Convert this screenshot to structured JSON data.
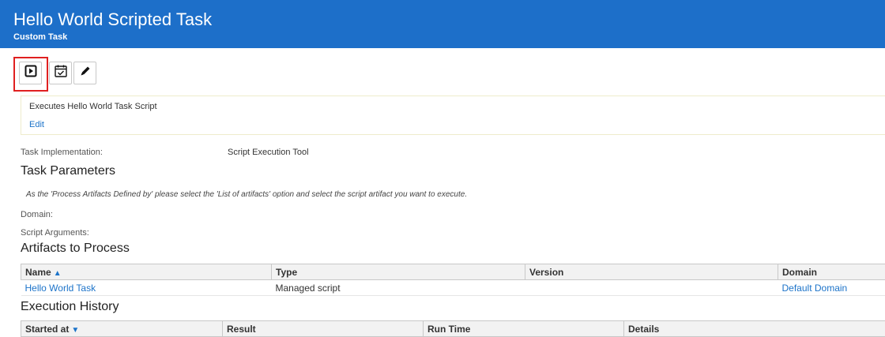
{
  "header": {
    "title": "Hello World Scripted Task",
    "subtitle": "Custom Task"
  },
  "toolbar": {
    "buttons": [
      {
        "name": "run",
        "icon": "play-icon"
      },
      {
        "name": "schedule",
        "icon": "calendar-check-icon"
      },
      {
        "name": "edit",
        "icon": "pencil-icon"
      }
    ]
  },
  "description": {
    "text": "Executes Hello World Task Script",
    "edit_label": "Edit"
  },
  "task_implementation": {
    "label": "Task Implementation:",
    "value": "Script Execution Tool"
  },
  "task_parameters": {
    "heading": "Task Parameters",
    "note": "As the 'Process Artifacts Defined by' please select the 'List of artifacts' option and select the script artifact you want to execute.",
    "domain_label": "Domain:",
    "script_arguments_label": "Script Arguments:"
  },
  "artifacts": {
    "heading": "Artifacts to Process",
    "columns": [
      "Name",
      "Type",
      "Version",
      "Domain"
    ],
    "sort_indicator": "▲",
    "rows": [
      {
        "name": "Hello World Task",
        "type": "Managed script",
        "version": "",
        "domain": "Default Domain"
      }
    ]
  },
  "execution_history": {
    "heading": "Execution History",
    "columns": [
      "Started at",
      "Result",
      "Run Time",
      "Details"
    ],
    "sort_indicator": "▼"
  },
  "colors": {
    "header_bg": "#1d6fc9",
    "link": "#1c73c9",
    "highlight": "#e02020"
  }
}
